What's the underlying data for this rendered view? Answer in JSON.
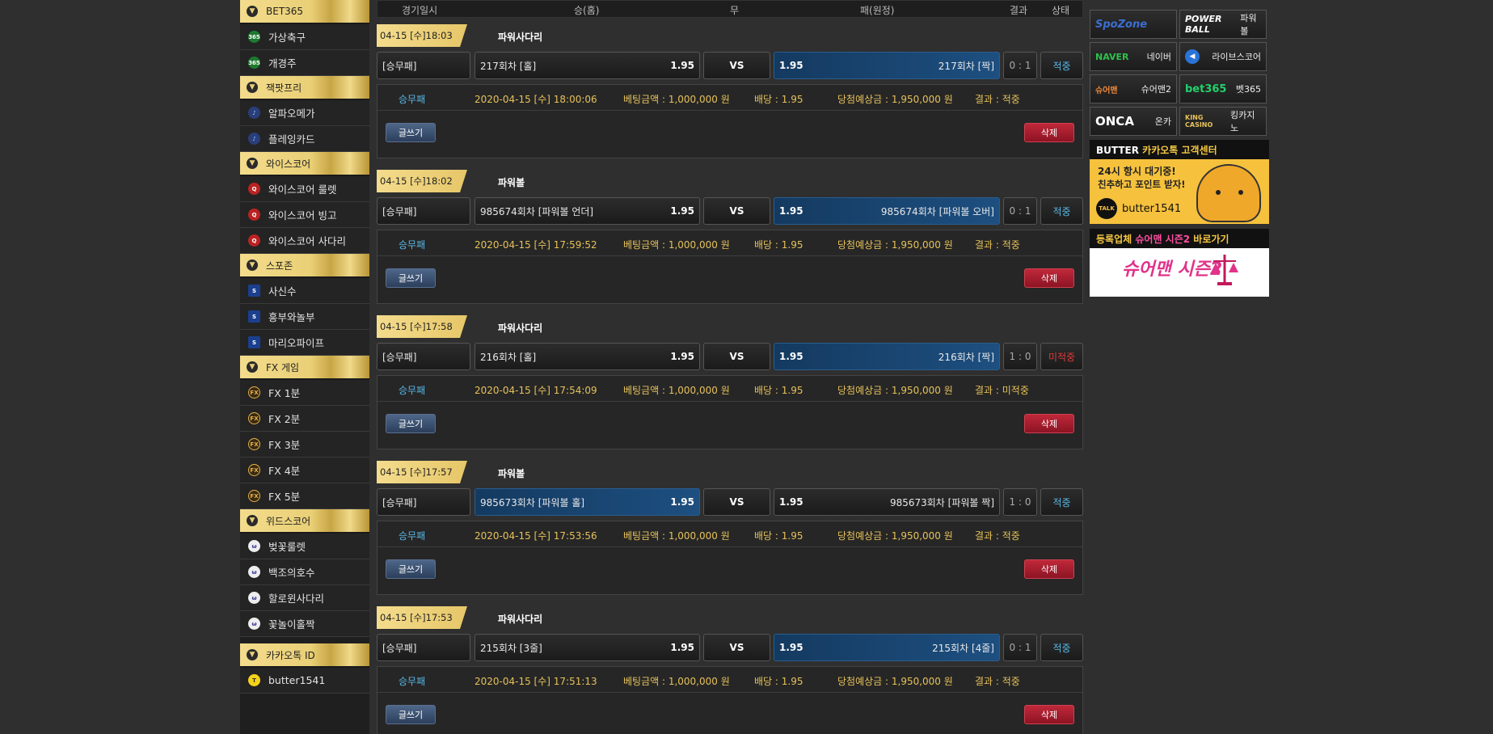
{
  "sidebar": {
    "groups": [
      {
        "title": "BET365",
        "items": [
          {
            "label": "가상축구",
            "icon": "bet365-icon"
          },
          {
            "label": "개경주",
            "icon": "bet365-icon"
          }
        ]
      },
      {
        "title": "잭팟프리",
        "items": [
          {
            "label": "알파오메가",
            "icon": "alpha-icon"
          },
          {
            "label": "플레잉카드",
            "icon": "alpha-icon"
          }
        ]
      },
      {
        "title": "와이스코어",
        "items": [
          {
            "label": "와이스코어 룰렛",
            "icon": "wisescore-icon"
          },
          {
            "label": "와이스코어 빙고",
            "icon": "wisescore-icon"
          },
          {
            "label": "와이스코어 사다리",
            "icon": "wisescore-icon"
          }
        ]
      },
      {
        "title": "스포존",
        "items": [
          {
            "label": "사신수",
            "icon": "spozone-icon"
          },
          {
            "label": "흥부와놀부",
            "icon": "spozone-icon"
          },
          {
            "label": "마리오파이프",
            "icon": "spozone-icon"
          }
        ]
      },
      {
        "title": "FX 게임",
        "items": [
          {
            "label": "FX 1분",
            "icon": "fx-icon"
          },
          {
            "label": "FX 2분",
            "icon": "fx-icon"
          },
          {
            "label": "FX 3분",
            "icon": "fx-icon"
          },
          {
            "label": "FX 4분",
            "icon": "fx-icon"
          },
          {
            "label": "FX 5분",
            "icon": "fx-icon"
          }
        ]
      },
      {
        "title": "위드스코어",
        "items": [
          {
            "label": "벚꽃룰렛",
            "icon": "withscore-icon"
          },
          {
            "label": "백조의호수",
            "icon": "withscore-icon"
          },
          {
            "label": "할로윈사다리",
            "icon": "withscore-icon"
          },
          {
            "label": "꽃놀이홀짝",
            "icon": "withscore-icon"
          }
        ]
      },
      {
        "title": "카카오톡 ID",
        "items": [
          {
            "label": "butter1541",
            "icon": "kakaotalk-icon"
          }
        ]
      }
    ]
  },
  "table_header": {
    "date": "경기일시",
    "win": "승(홈)",
    "draw": "무",
    "lose": "패(원정)",
    "result": "결과",
    "status": "상태"
  },
  "games": [
    {
      "time": "04-15 [수]18:03",
      "name": "파워사다리",
      "type": "[승무패]",
      "home": "217회차 [홀]",
      "home_odd": "1.95",
      "vs": "VS",
      "away_odd": "1.95",
      "away": "217회차 [짝]",
      "score": "0 : 1",
      "result": "적중",
      "bet_type": "승무패",
      "bet_time": "2020-04-15 [수] 18:00:06",
      "amount": "베팅금액 : 1,000,000 원",
      "odds": "배당 : 1.95",
      "payout": "당첨예상금 : 1,950,000 원",
      "outcome": "결과 : 적중",
      "write": "글쓰기",
      "delete": "삭제"
    },
    {
      "time": "04-15 [수]18:02",
      "name": "파워볼",
      "type": "[승무패]",
      "home": "985674회차 [파워볼 언더]",
      "home_odd": "1.95",
      "vs": "VS",
      "away_odd": "1.95",
      "away": "985674회차 [파워볼 오버]",
      "score": "0 : 1",
      "result": "적중",
      "bet_type": "승무패",
      "bet_time": "2020-04-15 [수] 17:59:52",
      "amount": "베팅금액 : 1,000,000 원",
      "odds": "배당 : 1.95",
      "payout": "당첨예상금 : 1,950,000 원",
      "outcome": "결과 : 적중",
      "write": "글쓰기",
      "delete": "삭제"
    },
    {
      "time": "04-15 [수]17:58",
      "name": "파워사다리",
      "type": "[승무패]",
      "home": "216회차 [홀]",
      "home_odd": "1.95",
      "vs": "VS",
      "away_odd": "1.95",
      "away": "216회차 [짝]",
      "score": "1 : 0",
      "result": "미적중",
      "bet_type": "승무패",
      "bet_time": "2020-04-15 [수] 17:54:09",
      "amount": "베팅금액 : 1,000,000 원",
      "odds": "배당 : 1.95",
      "payout": "당첨예상금 : 1,950,000 원",
      "outcome": "결과 : 미적중",
      "write": "글쓰기",
      "delete": "삭제"
    },
    {
      "time": "04-15 [수]17:57",
      "name": "파워볼",
      "type": "[승무패]",
      "home": "985673회차 [파워볼 홀]",
      "home_odd": "1.95",
      "vs": "VS",
      "away_odd": "1.95",
      "away": "985673회차 [파워볼 짝]",
      "score": "1 : 0",
      "result": "적중",
      "bet_type": "승무패",
      "bet_time": "2020-04-15 [수] 17:53:56",
      "amount": "베팅금액 : 1,000,000 원",
      "odds": "배당 : 1.95",
      "payout": "당첨예상금 : 1,950,000 원",
      "outcome": "결과 : 적중",
      "write": "글쓰기",
      "delete": "삭제"
    },
    {
      "time": "04-15 [수]17:53",
      "name": "파워사다리",
      "type": "[승무패]",
      "home": "215회차 [3줄]",
      "home_odd": "1.95",
      "vs": "VS",
      "away_odd": "1.95",
      "away": "215회차 [4줄]",
      "score": "0 : 1",
      "result": "적중",
      "bet_type": "승무패",
      "bet_time": "2020-04-15 [수] 17:51:13",
      "amount": "베팅금액 : 1,000,000 원",
      "odds": "배당 : 1.95",
      "payout": "당첨예상금 : 1,950,000 원",
      "outcome": "결과 : 적중",
      "write": "글쓰기",
      "delete": "삭제"
    }
  ],
  "links": [
    {
      "logo": "SpoZone",
      "label": ""
    },
    {
      "logo": "POWER BALL",
      "label": "파워볼"
    },
    {
      "logo": "NAVER",
      "label": "네이버"
    },
    {
      "logo": "◀",
      "label": "라이브스코어"
    },
    {
      "logo": "슈어맨",
      "label": "슈어맨2"
    },
    {
      "logo": "bet365",
      "label": "벳365"
    },
    {
      "logo": "ONCA",
      "label": "온카"
    },
    {
      "logo": "KING CASINO",
      "label": "킹카지노"
    }
  ],
  "banner_kakao": {
    "title_brand": "BUTTER",
    "title_rest": "카카오톡 고객센터",
    "line1": "24시 항시 대기중!",
    "line2": "친추하고 포인트 받자!",
    "badge": "TALK",
    "id": "butter1541"
  },
  "banner_sureman": {
    "title_prefix": "등록업체",
    "title_highlight": "슈어맨 시즌2",
    "title_suffix": "바로가기",
    "logo_text": "슈어맨 시즌2"
  },
  "colors": {
    "gold": "#e9cf76",
    "win": "#58b8e8",
    "lose": "#e03a3a",
    "selected": "#1d4f80"
  }
}
